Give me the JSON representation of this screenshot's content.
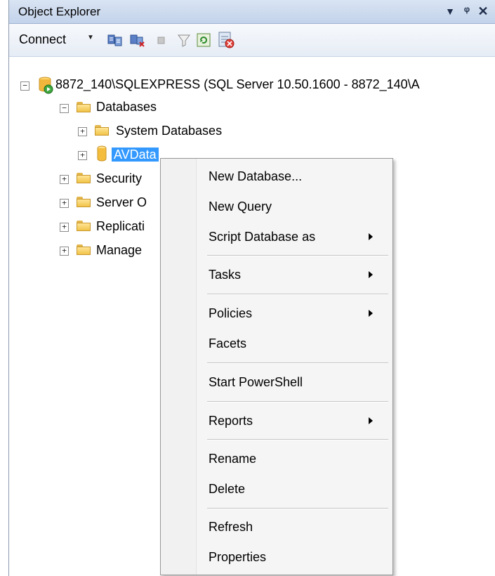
{
  "window": {
    "title": "Object Explorer",
    "buttons": {
      "dropdown": "▾",
      "pin": "ᵖ",
      "close": "✕"
    }
  },
  "toolbar": {
    "connect_label": "Connect",
    "icons": [
      "connect-db-icon",
      "disconnect-db-icon",
      "stop-icon",
      "filter-icon",
      "refresh-icon",
      "activity-monitor-icon"
    ]
  },
  "tree": {
    "server": "8872_140\\SQLEXPRESS (SQL Server 10.50.1600 - 8872_140\\A",
    "databases": "Databases",
    "system_databases": "System Databases",
    "avdata": "AVData",
    "security": "Security",
    "server_objects": "Server O",
    "replication": "Replicati",
    "management": "Manage"
  },
  "context_menu": {
    "new_database": "New Database...",
    "new_query": "New Query",
    "script_database_as": "Script Database as",
    "tasks": "Tasks",
    "policies": "Policies",
    "facets": "Facets",
    "start_powershell": "Start PowerShell",
    "reports": "Reports",
    "rename": "Rename",
    "delete": "Delete",
    "refresh": "Refresh",
    "properties": "Properties"
  },
  "colors": {
    "selection": "#3399ff",
    "titlebar": "#c3d3ea",
    "folder": "#f1c349"
  }
}
